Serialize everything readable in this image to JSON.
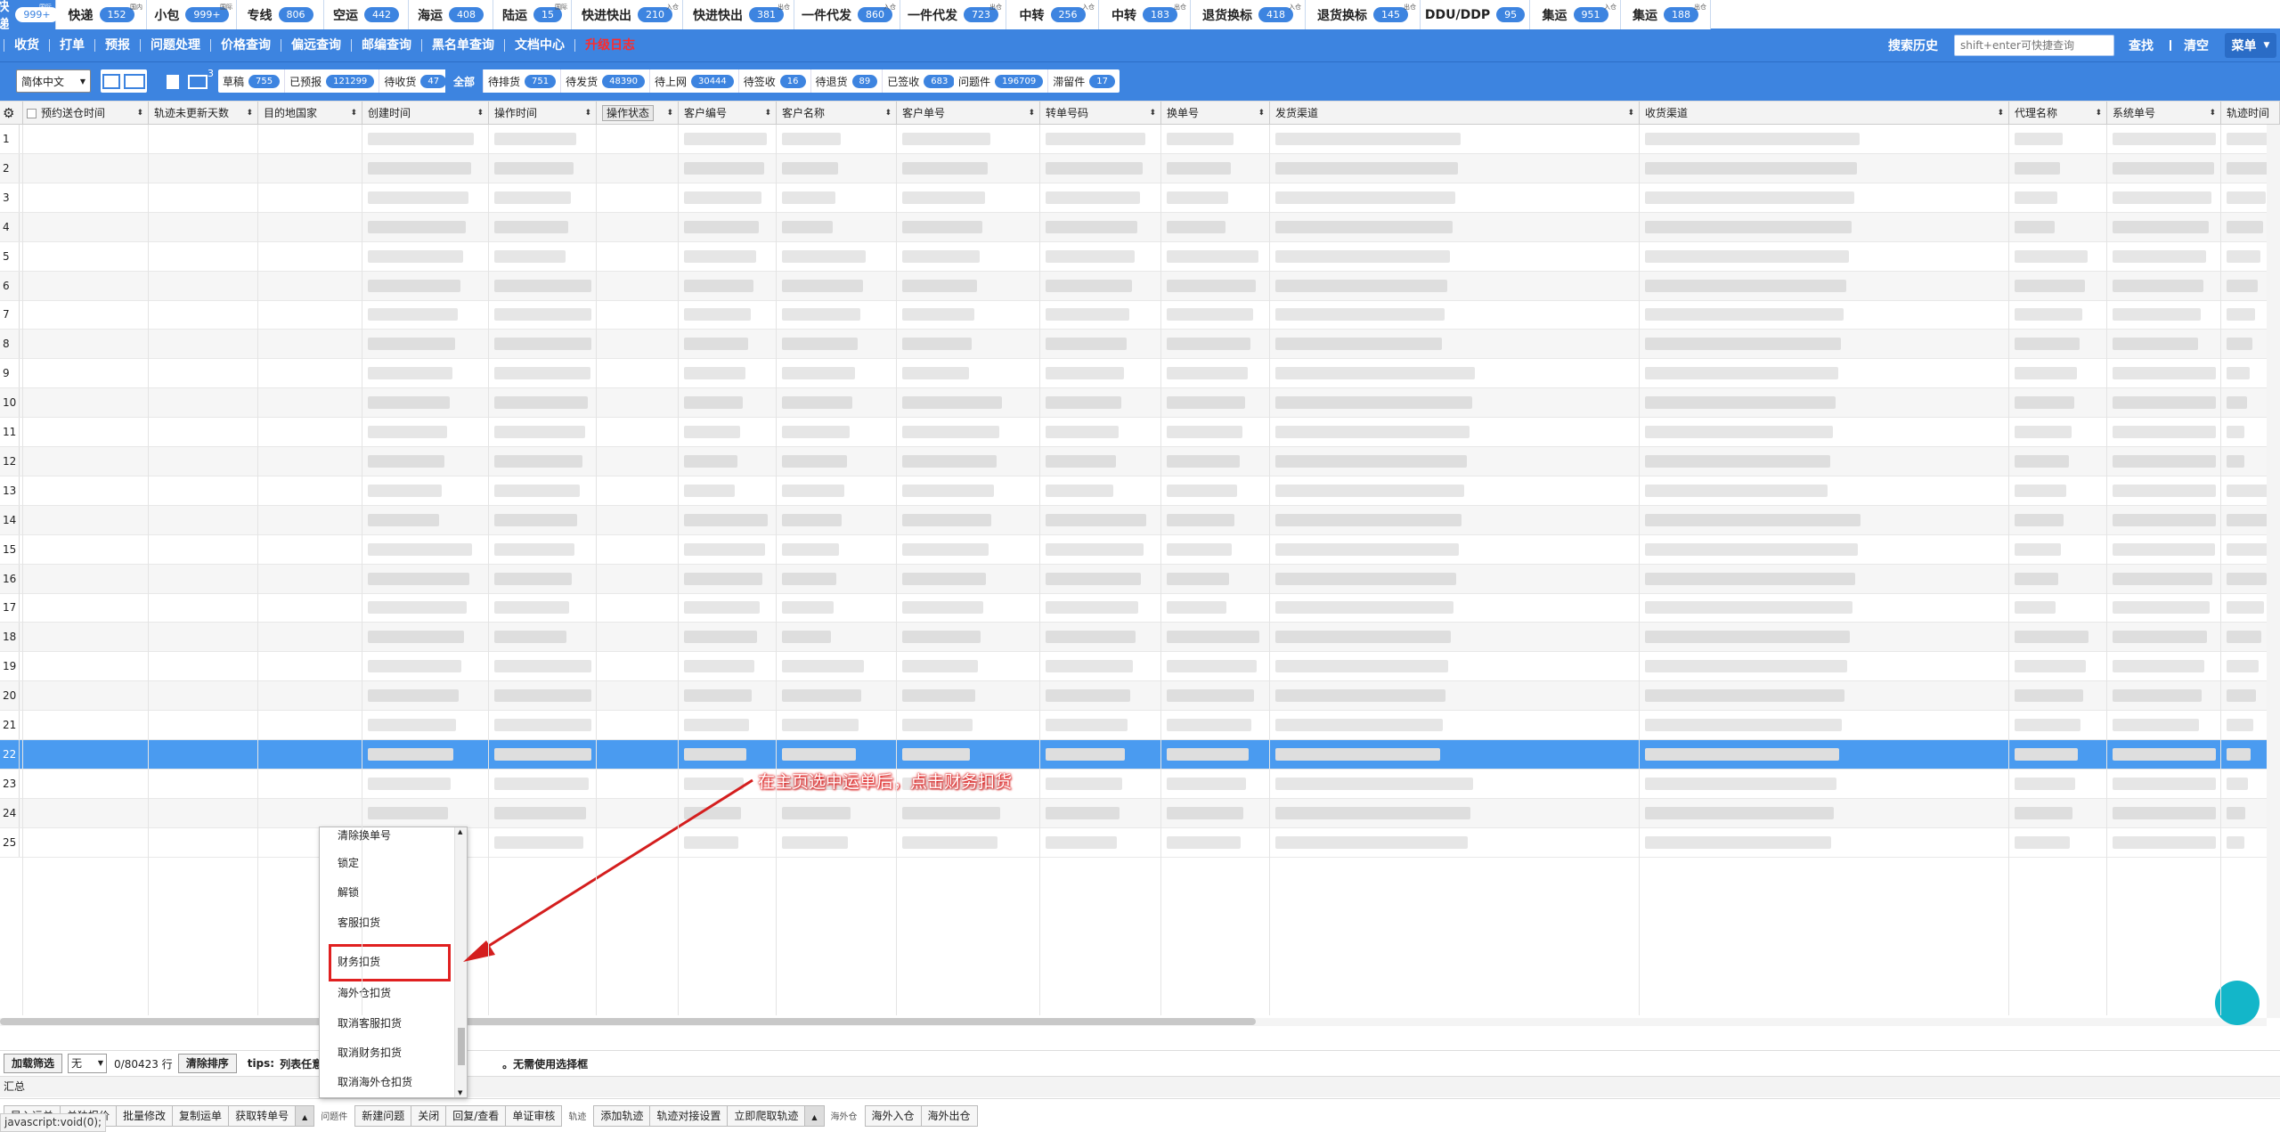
{
  "tabs": [
    {
      "label": "快递",
      "badge": "999+",
      "sup": "国际",
      "active": true
    },
    {
      "label": "快递",
      "badge": "152",
      "sup": "国内"
    },
    {
      "label": "小包",
      "badge": "999+",
      "sup": "国际"
    },
    {
      "label": "专线",
      "badge": "806",
      "sup": ""
    },
    {
      "label": "空运",
      "badge": "442",
      "sup": ""
    },
    {
      "label": "海运",
      "badge": "408",
      "sup": ""
    },
    {
      "label": "陆运",
      "badge": "15",
      "sup": "国际"
    },
    {
      "label": "快进快出",
      "badge": "210",
      "sup": "入仓"
    },
    {
      "label": "快进快出",
      "badge": "381",
      "sup": "出仓"
    },
    {
      "label": "一件代发",
      "badge": "860",
      "sup": "入仓"
    },
    {
      "label": "一件代发",
      "badge": "723",
      "sup": "出仓"
    },
    {
      "label": "中转",
      "badge": "256",
      "sup": "入仓"
    },
    {
      "label": "中转",
      "badge": "183",
      "sup": "出仓"
    },
    {
      "label": "退货换标",
      "badge": "418",
      "sup": "入仓"
    },
    {
      "label": "退货换标",
      "badge": "145",
      "sup": "出仓"
    },
    {
      "label": "DDU/DDP",
      "badge": "95",
      "sup": ""
    },
    {
      "label": "集运",
      "badge": "951",
      "sup": "入仓"
    },
    {
      "label": "集运",
      "badge": "188",
      "sup": "出仓"
    }
  ],
  "menu": {
    "items": [
      "收货",
      "打单",
      "预报",
      "问题处理",
      "价格查询",
      "偏远查询",
      "邮编查询",
      "黑名单查询",
      "文档中心"
    ],
    "upgrade": "升级日志",
    "search_history": "搜索历史",
    "search_placeholder": "shift+enter可快捷查询",
    "find": "查找",
    "clear": "清空",
    "menu_btn": "菜单"
  },
  "filter": {
    "lang": "简体中文",
    "envelope_badge": "3",
    "chips_a": [
      {
        "label": "草稿",
        "badge": "755"
      },
      {
        "label": "已预报",
        "badge": "121299"
      },
      {
        "label": "待收货",
        "badge": "47"
      }
    ],
    "all": "全部",
    "chips_b": [
      {
        "label": "待排货",
        "badge": "751"
      },
      {
        "label": "待发货",
        "badge": "48390"
      },
      {
        "label": "待上网",
        "badge": "30444"
      },
      {
        "label": "待签收",
        "badge": "16"
      },
      {
        "label": "待退货",
        "badge": "89"
      },
      {
        "label": "已签收",
        "badge": "683"
      }
    ],
    "chips_c": [
      {
        "label": "问题件",
        "badge": "196709"
      },
      {
        "label": "滞留件",
        "badge": "17"
      }
    ]
  },
  "columns": [
    "预约送仓时间",
    "轨迹未更新天数",
    "目的地国家",
    "创建时间",
    "操作时间",
    "操作状态",
    "客户编号",
    "客户名称",
    "客户单号",
    "转单号码",
    "换单号",
    "发货渠道",
    "收货渠道",
    "代理名称",
    "系统单号",
    "轨迹时间"
  ],
  "row_numbers": [
    "1",
    "2",
    "3",
    "4",
    "5",
    "6",
    "7",
    "8",
    "9",
    "10",
    "11",
    "12",
    "13",
    "14",
    "15",
    "16",
    "17",
    "18",
    "19",
    "20",
    "21",
    "22",
    "23",
    "24",
    "25"
  ],
  "popup_items": [
    "清除换单号",
    "锁定",
    "解锁",
    "客服扣货",
    "财务扣货",
    "海外仓扣货",
    "取消客服扣货",
    "取消财务扣货",
    "取消海外仓扣货"
  ],
  "annotation": "在主页选中运单后，点击财务扣货",
  "status": {
    "load_filter": "加载筛选",
    "none": "无",
    "count": "0/80423 行",
    "clear_sort": "清除排序",
    "tips_label": "tips:",
    "tips_a": "列表任意位",
    "tips_b": "。无需使用选择框"
  },
  "summary": "汇总",
  "actions": {
    "group1": [
      "导入运单",
      "单独报价",
      "批量修改",
      "复制运单",
      "获取转单号"
    ],
    "q_label": "问题件",
    "group2": [
      "新建问题",
      "关闭",
      "回复/查看",
      "单证审核"
    ],
    "t_label": "轨迹",
    "group3": [
      "添加轨迹",
      "轨迹对接设置",
      "立即爬取轨迹"
    ],
    "w_label": "海外仓",
    "group4": [
      "海外入仓",
      "海外出仓"
    ]
  },
  "status_url": "javascript:void(0);"
}
